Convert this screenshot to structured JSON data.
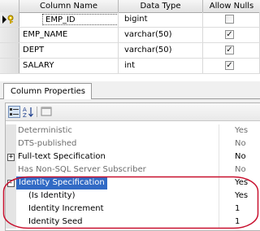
{
  "grid": {
    "headers": [
      "Column Name",
      "Data Type",
      "Allow Nulls"
    ],
    "rows": [
      {
        "name": "EMP_ID",
        "type": "bigint",
        "allow_nulls": false,
        "is_key": true
      },
      {
        "name": "EMP_NAME",
        "type": "varchar(50)",
        "allow_nulls": true,
        "is_key": false
      },
      {
        "name": "DEPT",
        "type": "varchar(50)",
        "allow_nulls": true,
        "is_key": false
      },
      {
        "name": "SALARY",
        "type": "int",
        "allow_nulls": true,
        "is_key": false
      }
    ]
  },
  "panel": {
    "tab_label": "Column Properties",
    "toolbar_icons": [
      "categorized-icon",
      "alphabetical-sort-icon",
      "property-pages-icon"
    ],
    "properties": [
      {
        "name": "Deterministic",
        "value": "Yes",
        "dim": true,
        "expander": ""
      },
      {
        "name": "DTS-published",
        "value": "No",
        "dim": true,
        "expander": ""
      },
      {
        "name": "Full-text Specification",
        "value": "No",
        "dim": false,
        "expander": "+"
      },
      {
        "name": "Has Non-SQL Server Subscriber",
        "value": "No",
        "dim": true,
        "expander": ""
      },
      {
        "name": "Identity Specification",
        "value": "Yes",
        "dim": false,
        "expander": "-",
        "selected": true
      },
      {
        "name": "(Is Identity)",
        "value": "Yes",
        "dim": false,
        "expander": "",
        "sub": true
      },
      {
        "name": "Identity Increment",
        "value": "1",
        "dim": false,
        "expander": "",
        "sub": true
      },
      {
        "name": "Identity Seed",
        "value": "1",
        "dim": false,
        "expander": "",
        "sub": true
      }
    ]
  },
  "colors": {
    "selection": "#316ac5",
    "annotation_oval": "#c8102e"
  }
}
